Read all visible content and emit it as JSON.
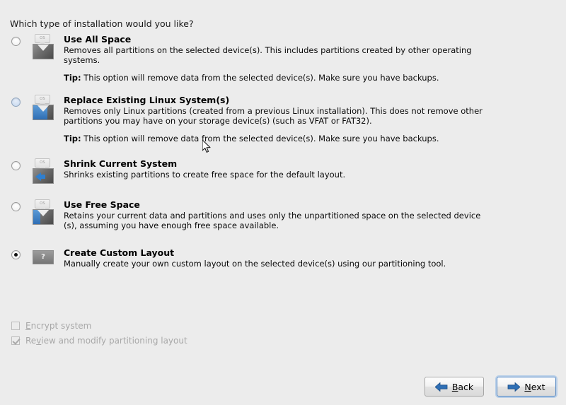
{
  "heading": "Which type of installation would you like?",
  "options": [
    {
      "id": "use-all-space",
      "title": "Use All Space",
      "desc": "Removes all partitions on the selected device(s).  This includes partitions created by other operating systems.",
      "tip_label": "Tip:",
      "tip": "This option will remove data from the selected device(s).  Make sure you have backups.",
      "selected": false,
      "hover": false,
      "icon": "disk-erase-icon",
      "icon_tag_text": "OS"
    },
    {
      "id": "replace-existing-linux",
      "title": "Replace Existing Linux System(s)",
      "desc": "Removes only Linux partitions (created from a previous Linux installation).  This does not remove other partitions you may have on your storage device(s) (such as VFAT or FAT32).",
      "tip_label": "Tip:",
      "tip": "This option will remove data from the selected device(s).  Make sure you have backups.",
      "selected": false,
      "hover": true,
      "icon": "disk-replace-linux-icon",
      "icon_tag_text": "OS"
    },
    {
      "id": "shrink-current-system",
      "title": "Shrink Current System",
      "desc": "Shrinks existing partitions to create free space for the default layout.",
      "tip_label": "",
      "tip": "",
      "selected": false,
      "hover": false,
      "icon": "disk-shrink-icon",
      "icon_tag_text": "OS"
    },
    {
      "id": "use-free-space",
      "title": "Use Free Space",
      "desc": "Retains your current data and partitions and uses only the unpartitioned space on the selected device (s), assuming you have enough free space available.",
      "tip_label": "",
      "tip": "",
      "selected": false,
      "hover": false,
      "icon": "disk-free-space-icon",
      "icon_tag_text": "OS"
    },
    {
      "id": "create-custom-layout",
      "title": "Create Custom Layout",
      "desc": "Manually create your own custom layout on the selected device(s) using our partitioning tool.",
      "tip_label": "",
      "tip": "",
      "selected": true,
      "hover": false,
      "icon": "disk-custom-question-icon",
      "icon_tag_text": "?"
    }
  ],
  "checkboxes": [
    {
      "id": "encrypt-system",
      "label_pre": "",
      "accel": "E",
      "label_post": "ncrypt system",
      "checked": false,
      "disabled": true
    },
    {
      "id": "review-modify-layout",
      "label_pre": "Re",
      "accel": "v",
      "label_post": "iew and modify partitioning layout",
      "checked": true,
      "disabled": true
    }
  ],
  "buttons": {
    "back": {
      "label_pre": "",
      "accel": "B",
      "label_post": "ack",
      "icon": "arrow-left-icon",
      "focused": false
    },
    "next": {
      "label_pre": "",
      "accel": "N",
      "label_post": "ext",
      "icon": "arrow-right-icon",
      "focused": true
    }
  },
  "colors": {
    "background": "#ececec",
    "accent_blue": "#2f7fcf",
    "focus_blue": "#5a8bc4",
    "disabled_text": "#a8a8a8"
  }
}
